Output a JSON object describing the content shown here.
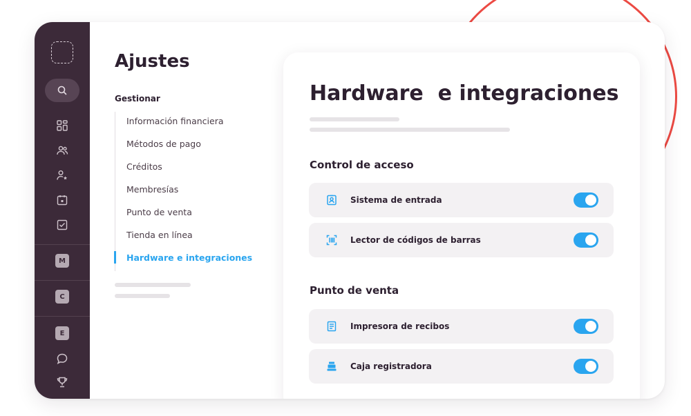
{
  "colors": {
    "rail_bg": "#3c2a39",
    "accent": "#2aa5ef",
    "decor_circle": "#ec4a43",
    "row_bg": "#f3f1f3"
  },
  "sidebar": {
    "icons": [
      "logo-placeholder-icon",
      "search-icon",
      "dashboard-icon",
      "users-icon",
      "user-star-icon",
      "calendar-icon",
      "checklist-icon",
      "chat-icon",
      "trophy-icon"
    ],
    "badges": [
      "M",
      "C",
      "E"
    ]
  },
  "settings": {
    "title": "Ajustes",
    "group_label": "Gestionar",
    "items": [
      "Información financiera",
      "Métodos de pago",
      "Créditos",
      "Membresías",
      "Punto de venta",
      "Tienda en línea",
      "Hardware e integraciones"
    ],
    "active_index": 6
  },
  "main": {
    "title": "Hardware  e integraciones",
    "sections": [
      {
        "title": "Control de acceso",
        "rows": [
          {
            "label": "Sistema de entrada",
            "icon": "badge-id-icon",
            "enabled": true
          },
          {
            "label": "Lector de códigos de barras",
            "icon": "barcode-scanner-icon",
            "enabled": true
          }
        ]
      },
      {
        "title": "Punto de venta",
        "rows": [
          {
            "label": "Impresora de recibos",
            "icon": "receipt-printer-icon",
            "enabled": true
          },
          {
            "label": "Caja registradora",
            "icon": "cash-register-icon",
            "enabled": true
          }
        ]
      }
    ]
  }
}
